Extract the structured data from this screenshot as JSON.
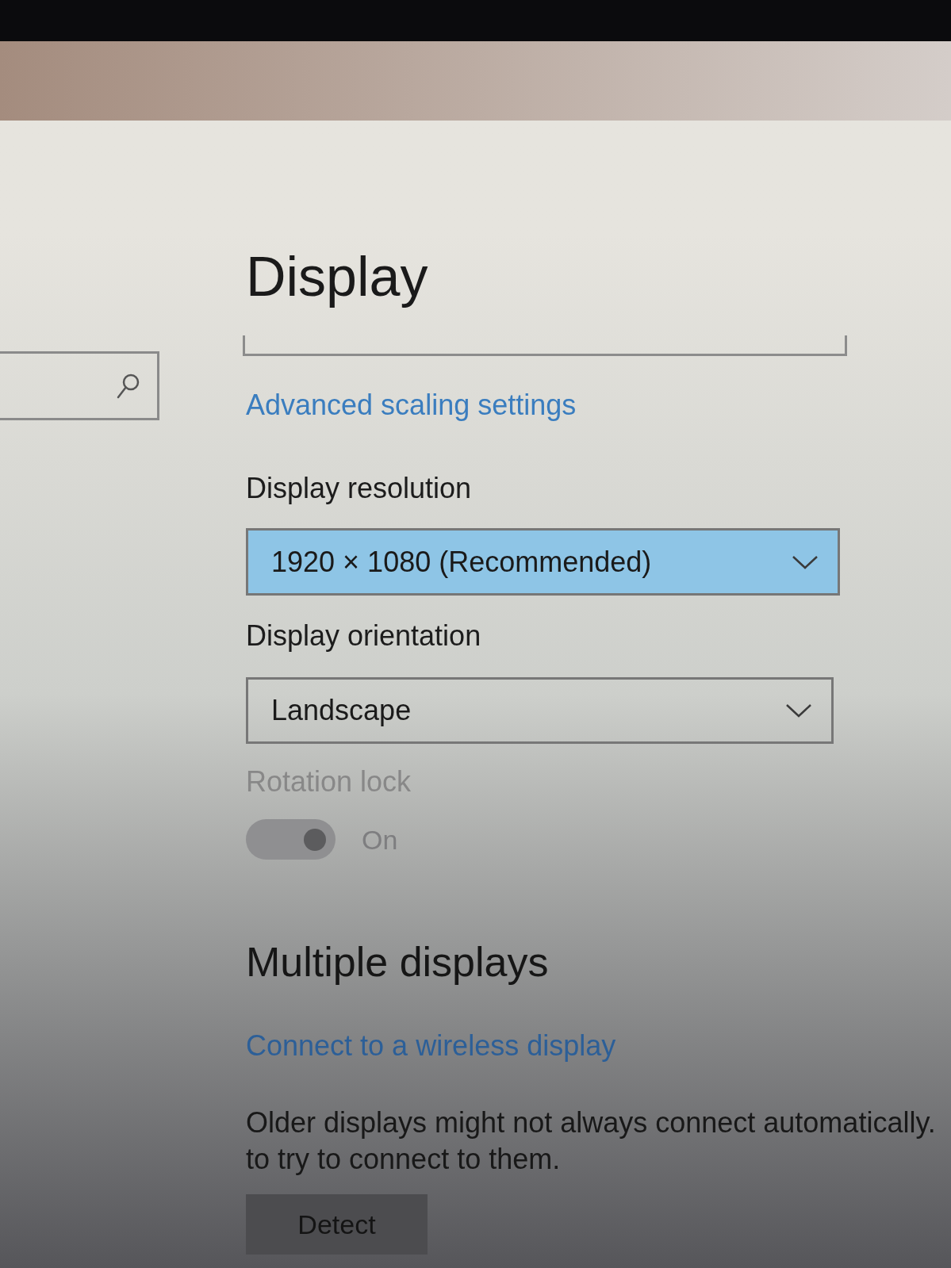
{
  "header": {
    "title": "Display"
  },
  "scale_link": "Advanced scaling settings",
  "resolution": {
    "label": "Display resolution",
    "value": "1920 × 1080 (Recommended)",
    "highlighted": true
  },
  "orientation": {
    "label": "Display orientation",
    "value": "Landscape",
    "highlighted": false
  },
  "rotation_lock": {
    "label": "Rotation lock",
    "on": true,
    "disabled": true,
    "state_text": "On"
  },
  "multiple_displays": {
    "title": "Multiple displays",
    "link": "Connect to a wireless display",
    "description_lines": [
      "Older displays might not always connect automatically.",
      "to try to connect to them."
    ],
    "button": "Detect"
  }
}
